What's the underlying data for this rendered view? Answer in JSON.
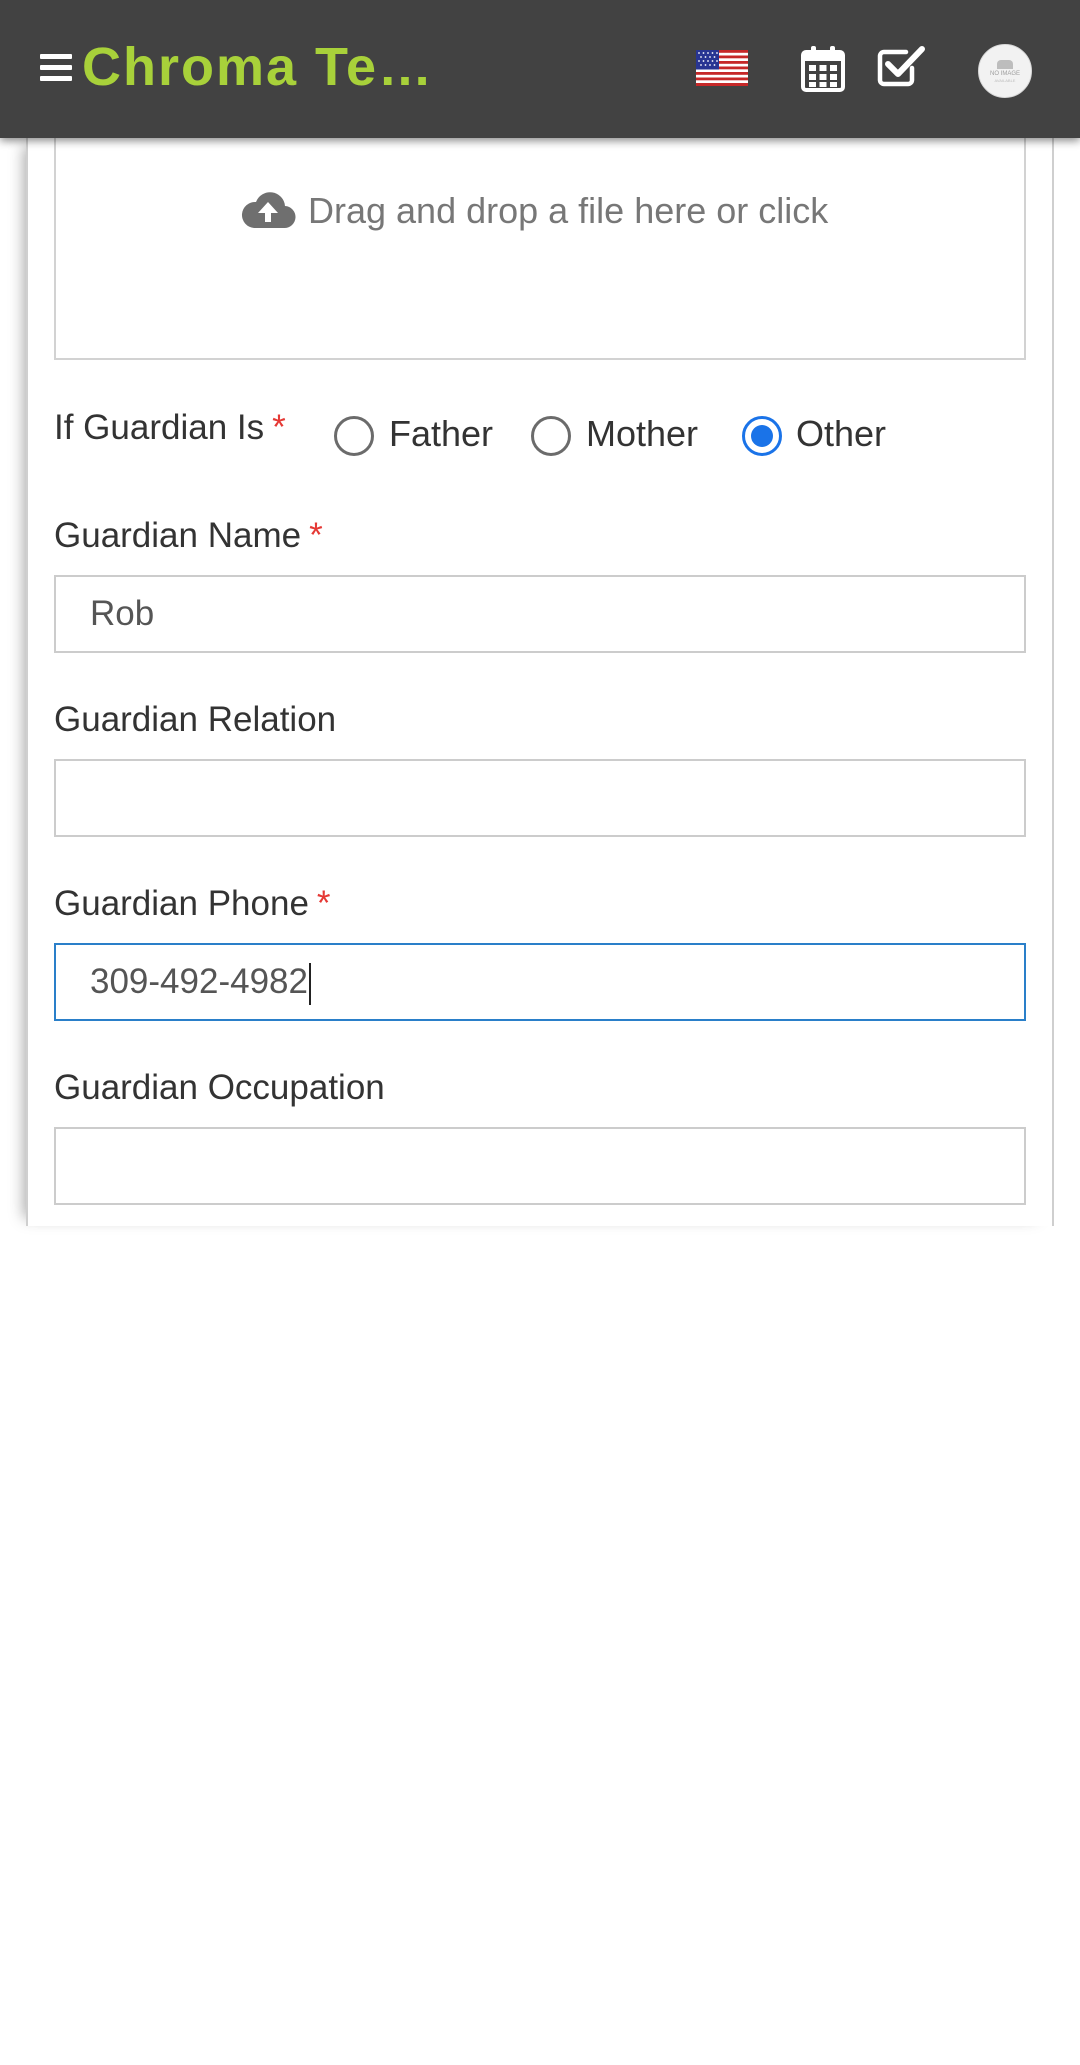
{
  "app": {
    "title": "Chroma Te…"
  },
  "header": {
    "menu_icon": "hamburger-menu-icon",
    "language_flag": "us-flag-icon",
    "calendar_icon": "calendar-icon",
    "tasks_icon": "checkbox-icon",
    "avatar": {
      "line1": "NO IMAGE",
      "line2": "AVAILABLE"
    }
  },
  "upload": {
    "icon": "cloud-upload-icon",
    "text": "Drag and drop a file here or click"
  },
  "guardian_is": {
    "label": "If Guardian Is",
    "required_mark": "*",
    "options": [
      {
        "label": "Father",
        "checked": false
      },
      {
        "label": "Mother",
        "checked": false
      },
      {
        "label": "Other",
        "checked": true
      }
    ]
  },
  "guardian_name": {
    "label": "Guardian Name",
    "required_mark": "*",
    "value": "Rob"
  },
  "guardian_relation": {
    "label": "Guardian Relation",
    "value": ""
  },
  "guardian_phone": {
    "label": "Guardian Phone",
    "required_mark": "*",
    "value": "309-492-4982"
  },
  "guardian_occupation": {
    "label": "Guardian Occupation",
    "value": ""
  },
  "colors": {
    "header_bg": "#424242",
    "brand": "#a8d13a",
    "accent": "#1a73e8",
    "required": "#e53935"
  }
}
